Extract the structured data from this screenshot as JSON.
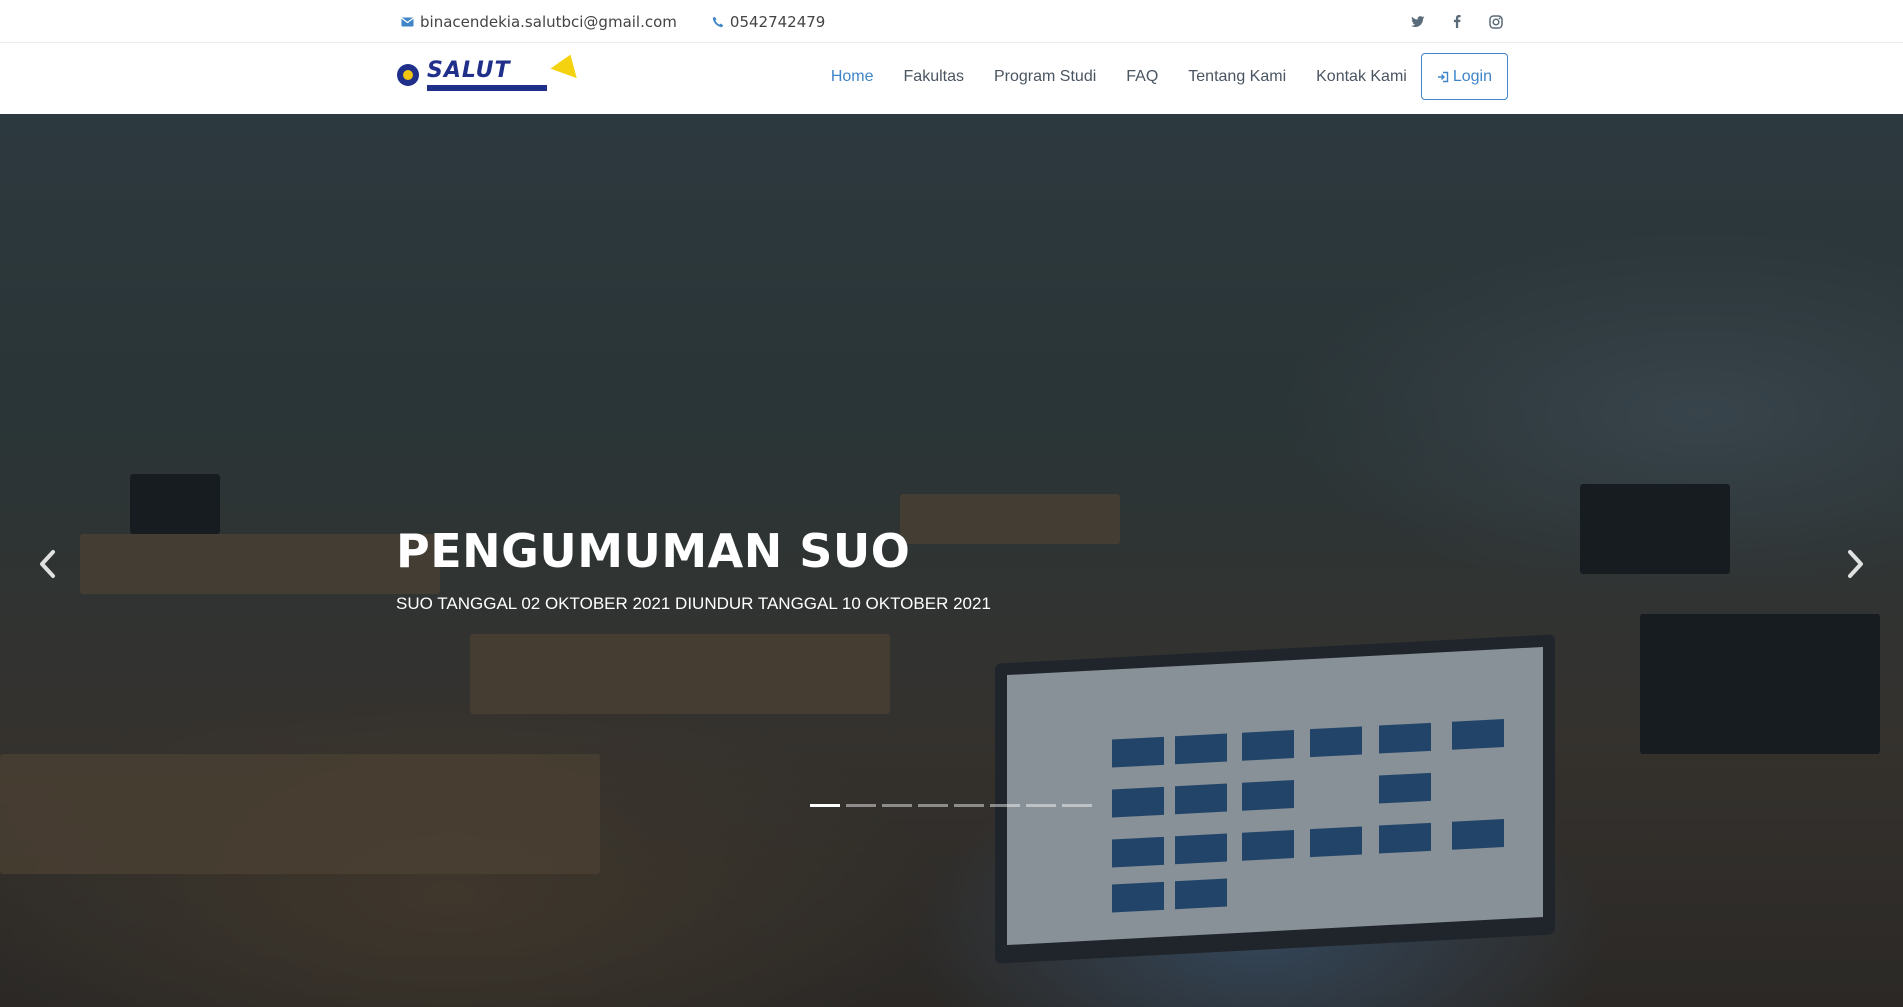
{
  "topbar": {
    "email": "binacendekia.salutbci@gmail.com",
    "phone": "0542742479",
    "social": [
      {
        "icon": "twitter-icon"
      },
      {
        "icon": "facebook-icon"
      },
      {
        "icon": "instagram-icon"
      }
    ]
  },
  "header": {
    "logo_text": "SALUT",
    "nav": [
      {
        "label": "Home",
        "active": true
      },
      {
        "label": "Fakultas",
        "active": false
      },
      {
        "label": "Program Studi",
        "active": false
      },
      {
        "label": "FAQ",
        "active": false
      },
      {
        "label": "Tentang Kami",
        "active": false
      },
      {
        "label": "Kontak Kami",
        "active": false
      }
    ],
    "login_label": "Login"
  },
  "hero": {
    "title": "PENGUMUMAN SUO",
    "subtitle": "SUO TANGGAL 02 OKTOBER 2021 DIUNDUR TANGGAL 10 OKTOBER 2021",
    "slide_count": 8,
    "active_slide": 0
  },
  "colors": {
    "accent": "#3f85c8",
    "brand_blue": "#1f2f8a",
    "brand_yellow": "#f5d20f"
  }
}
